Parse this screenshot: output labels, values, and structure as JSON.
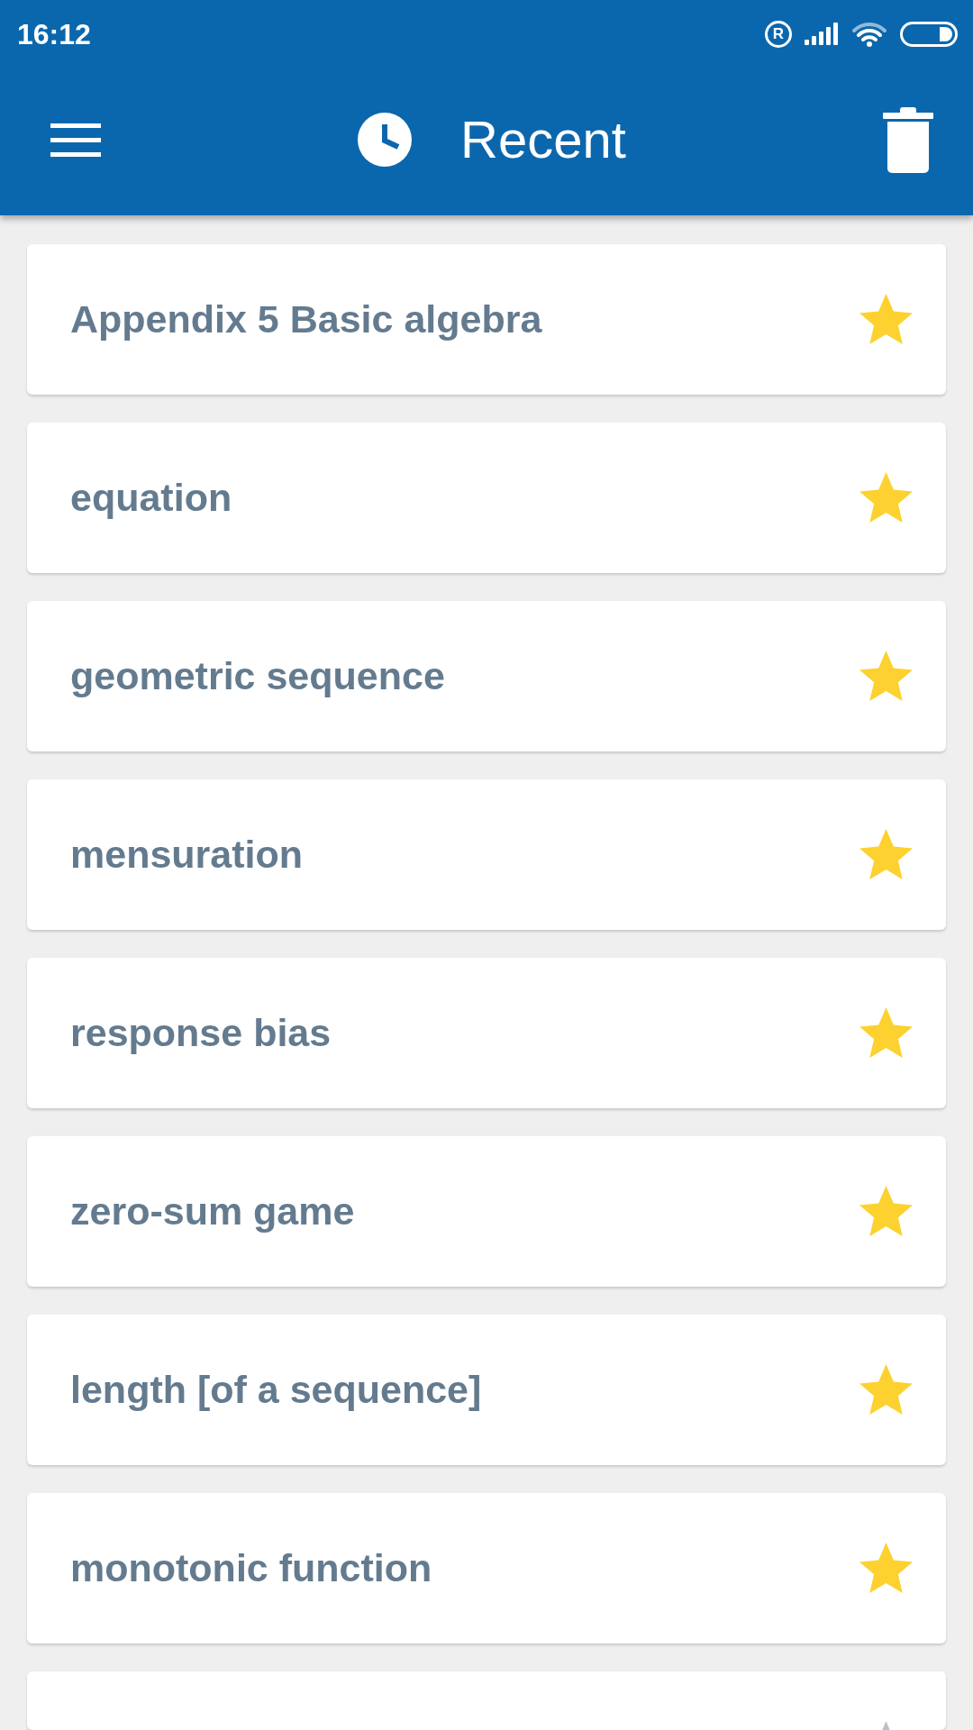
{
  "status_bar": {
    "time": "16:12",
    "roaming_mark": "R"
  },
  "app_bar": {
    "title": "Recent"
  },
  "items": [
    {
      "label": "Appendix 5 Basic algebra",
      "starred": true
    },
    {
      "label": "equation",
      "starred": true
    },
    {
      "label": "geometric sequence",
      "starred": true
    },
    {
      "label": "mensuration",
      "starred": true
    },
    {
      "label": "response bias",
      "starred": true
    },
    {
      "label": "zero-sum game",
      "starred": true
    },
    {
      "label": "length [of a sequence]",
      "starred": true
    },
    {
      "label": "monotonic function",
      "starred": true
    },
    {
      "starred": false
    }
  ]
}
